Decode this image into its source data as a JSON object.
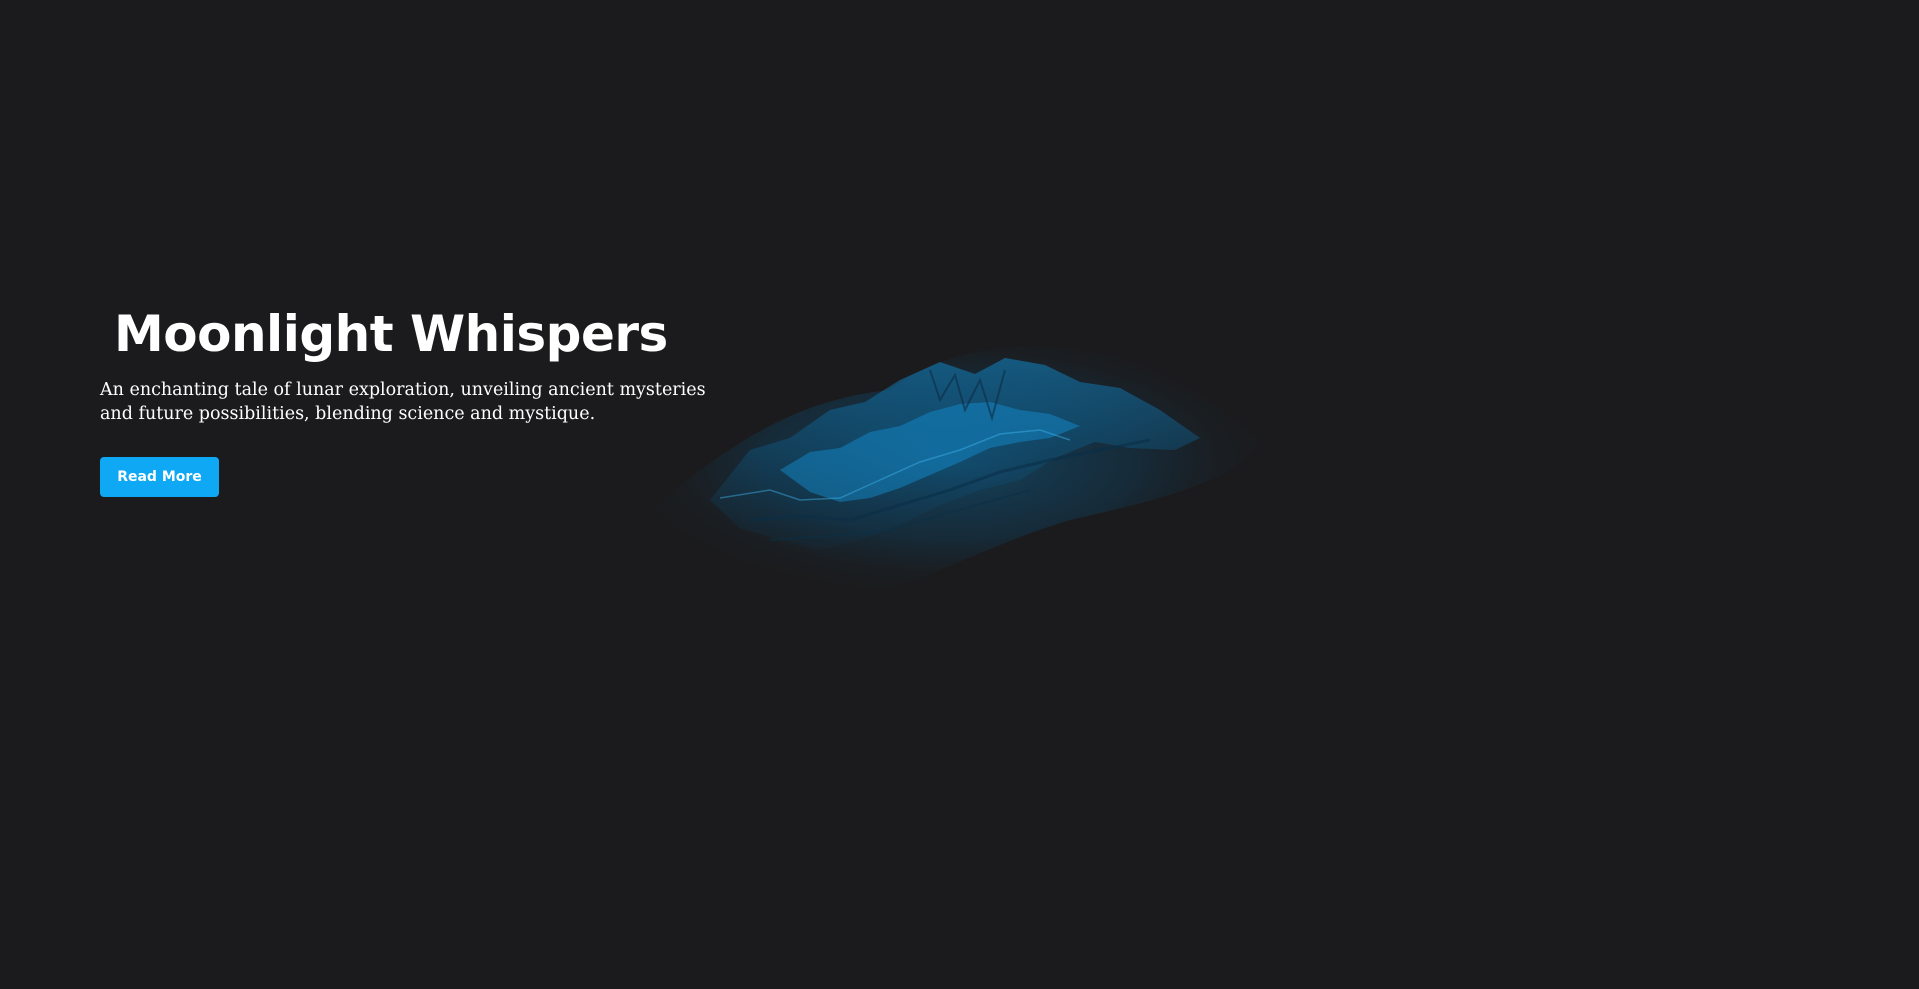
{
  "hero": {
    "title": "Moonlight Whispers",
    "description": "An enchanting tale of lunar exploration, unveiling ancient mysteries and future possibilities, blending science and mystique.",
    "button_label": "Read More"
  },
  "colors": {
    "background": "#1b1b1d",
    "accent": "#0ea8f4",
    "text": "#ffffff",
    "terrain": "#0b5d8c"
  }
}
